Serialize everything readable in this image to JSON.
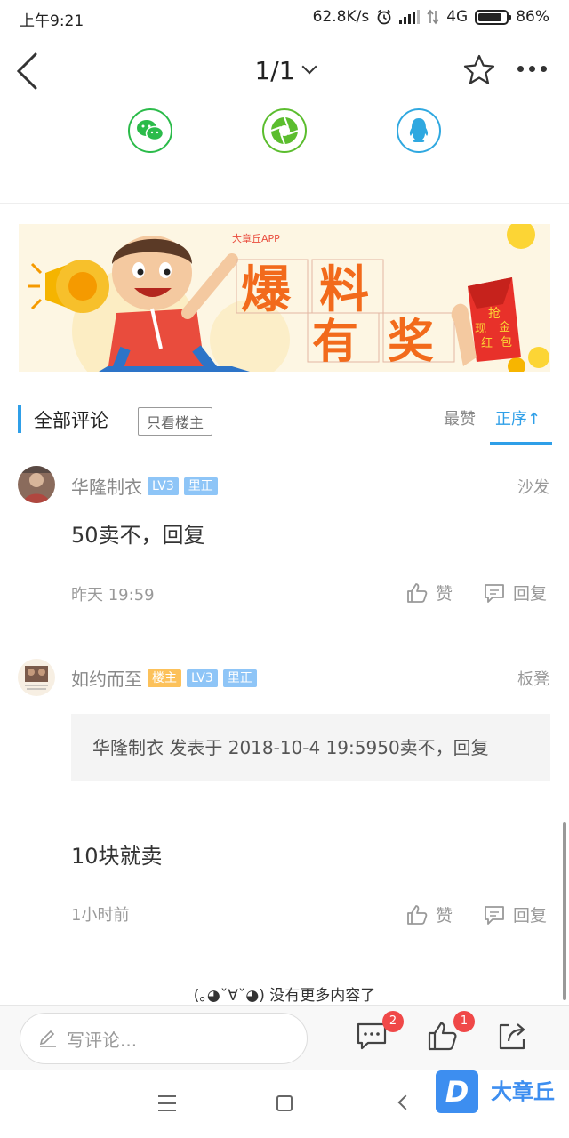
{
  "status": {
    "time": "上午9:21",
    "speed": "62.8K/s",
    "network": "4G",
    "battery": "86%"
  },
  "topbar": {
    "page_indicator": "1/1"
  },
  "share": {
    "wechat_icon": "wechat-icon",
    "moments_icon": "moments-icon",
    "qq_icon": "qq-icon"
  },
  "banner": {
    "app_name": "大章丘APP",
    "slogan_1": "爆",
    "slogan_2": "料",
    "slogan_3": "有",
    "slogan_4": "奖",
    "envelope_1": "抢",
    "envelope_2": "现",
    "envelope_3": "金",
    "envelope_4": "红",
    "envelope_5": "包"
  },
  "comments_header": {
    "title": "全部评论",
    "only_host": "只看楼主",
    "sort_hot": "最赞",
    "sort_order": "正序",
    "sort_arrow": "↑"
  },
  "comments": [
    {
      "user": "华隆制衣",
      "level": "LV3",
      "verified": "里正",
      "floor": "沙发",
      "text": "50卖不，回复",
      "time": "昨天 19:59",
      "like_label": "赞",
      "reply_label": "回复"
    },
    {
      "user": "如约而至",
      "host_badge": "楼主",
      "level": "LV3",
      "verified": "里正",
      "floor": "板凳",
      "quote": "华隆制衣 发表于 2018-10-4 19:5950卖不，回复",
      "text": "10块就卖",
      "time": "1小时前",
      "like_label": "赞",
      "reply_label": "回复"
    }
  ],
  "footer_note": "(｡◕ˇ∀ˇ◕) 没有更多内容了",
  "bottom_bar": {
    "input_placeholder": "写评论...",
    "comment_count": "2",
    "like_count": "1"
  },
  "nav": {
    "logo_letter": "D",
    "logo_text": "大章丘"
  },
  "colors": {
    "accent": "#2f9fe8",
    "badge_blue": "#8ec5f7",
    "badge_host": "#fcc15a",
    "notify_red": "#f04848"
  }
}
